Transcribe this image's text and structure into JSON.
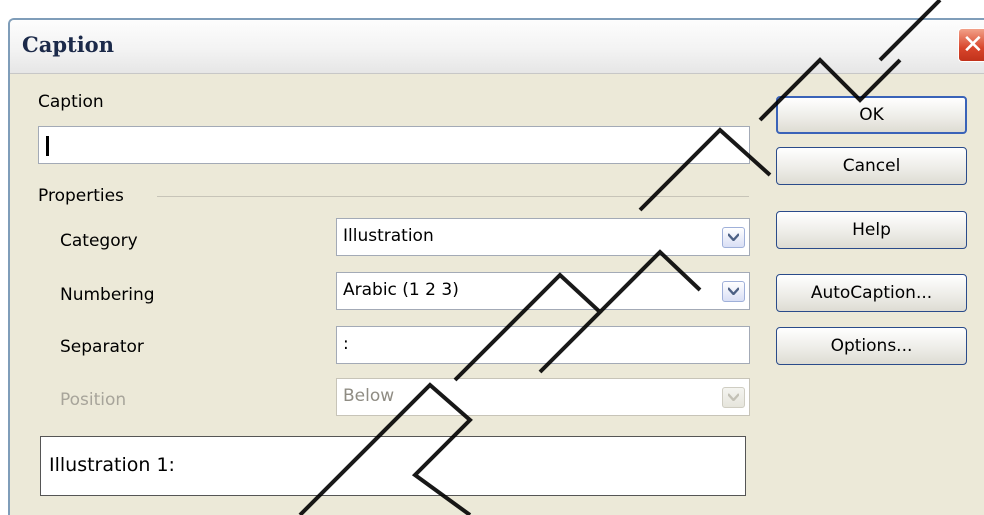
{
  "dialog": {
    "title": "Caption",
    "caption_label": "Caption",
    "caption_value": "",
    "properties_label": "Properties",
    "category": {
      "label": "Category",
      "value": "Illustration"
    },
    "numbering": {
      "label": "Numbering",
      "value": "Arabic (1 2 3)"
    },
    "separator": {
      "label": "Separator",
      "value": ":"
    },
    "position": {
      "label": "Position",
      "value": "Below",
      "disabled": true
    },
    "preview_text": "Illustration 1:"
  },
  "buttons": {
    "ok": "OK",
    "cancel": "Cancel",
    "help": "Help",
    "autocaption": "AutoCaption...",
    "options": "Options..."
  },
  "icons": {
    "close": "close-icon",
    "dropdown": "chevron-down-icon"
  },
  "colors": {
    "close_button": "#d8452b",
    "default_button_border": "#3a63b8",
    "dialog_background": "#ece9d8"
  }
}
